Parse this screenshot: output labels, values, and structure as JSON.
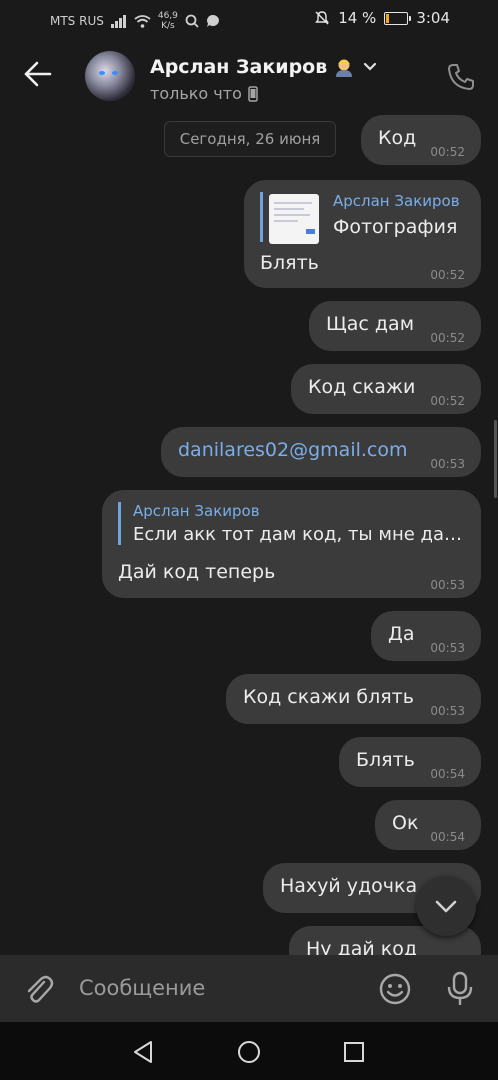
{
  "status_bar": {
    "carrier": "MTS RUS",
    "speed_value": "46,9",
    "speed_unit": "K/s",
    "battery_percent": "14 %",
    "battery_level": 0.14,
    "time": "3:04"
  },
  "header": {
    "contact_name": "Арслан Закиров",
    "status": "только что"
  },
  "date_separator": "Сегодня, 26 июня",
  "messages": [
    {
      "text": "Код",
      "time": "00:52"
    },
    {
      "reply_name": "Арслан Закиров",
      "reply_text": "Фотография",
      "text": "Блять",
      "time": "00:52"
    },
    {
      "text": "Щас дам",
      "time": "00:52"
    },
    {
      "text": "Код скажи",
      "time": "00:52"
    },
    {
      "text": "danilares02@gmail.com",
      "time": "00:53"
    },
    {
      "reply_name": "Арслан Закиров",
      "reply_text": "Если акк тот дам код, ты мне да…",
      "text": "Дай код теперь",
      "time": "00:53"
    },
    {
      "text": "Да",
      "time": "00:53"
    },
    {
      "text": "Код скажи блять",
      "time": "00:53"
    },
    {
      "text": "Блять",
      "time": "00:54"
    },
    {
      "text": "Ок",
      "time": "00:54"
    },
    {
      "text": "Нахуй удочка",
      "time": ""
    },
    {
      "text": "Ну дай код",
      "time": ""
    }
  ],
  "input": {
    "placeholder": "Сообщение"
  },
  "colors": {
    "background": "#1a1a1a",
    "bubble": "#3b3b3c",
    "accent": "#79aee9",
    "battery_fill": "#f5a623"
  }
}
